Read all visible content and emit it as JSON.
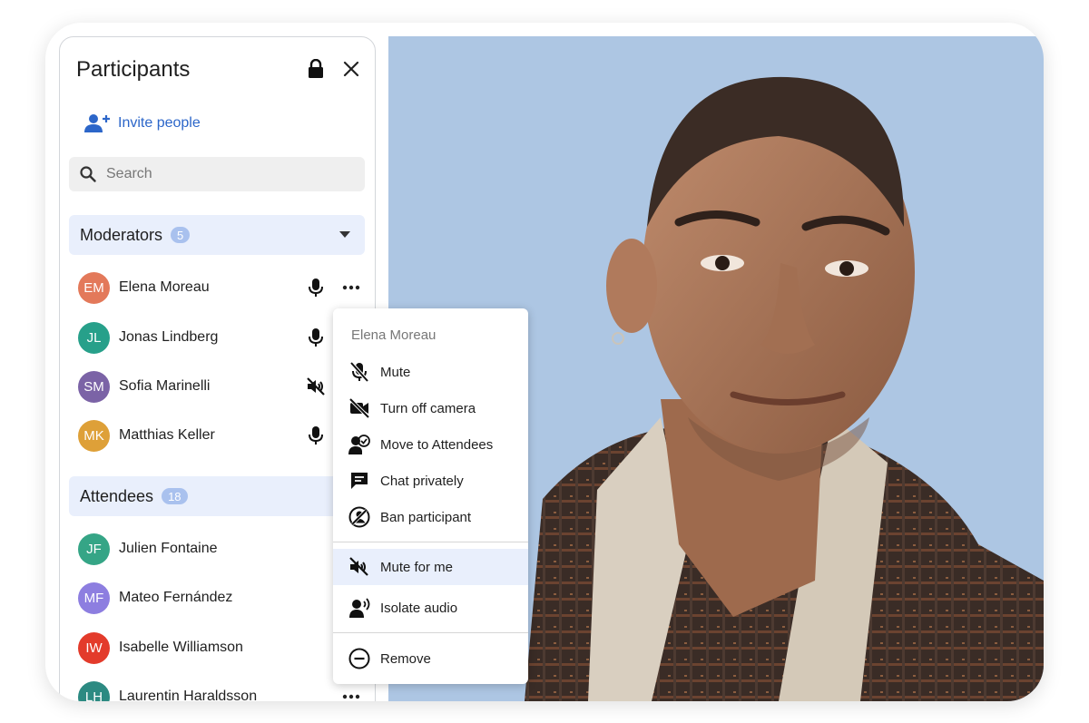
{
  "panel": {
    "title": "Participants",
    "invite_label": "Invite people",
    "search_placeholder": "Search",
    "moderators": {
      "label": "Moderators",
      "count": "5",
      "items": [
        {
          "initials": "EM",
          "name": "Elena Moreau",
          "color": "#e3795a",
          "mic": "on"
        },
        {
          "initials": "JL",
          "name": "Jonas Lindberg",
          "color": "#27a08a",
          "mic": "on"
        },
        {
          "initials": "SM",
          "name": "Sofia Marinelli",
          "color": "#7b63a6",
          "mic": "muted"
        },
        {
          "initials": "MK",
          "name": "Matthias Keller",
          "color": "#dea038",
          "mic": "on"
        }
      ]
    },
    "attendees": {
      "label": "Attendees",
      "count": "18",
      "items": [
        {
          "initials": "JF",
          "name": "Julien Fontaine",
          "color": "#35a586"
        },
        {
          "initials": "MF",
          "name": "Mateo Fernández",
          "color": "#8d7ee0"
        },
        {
          "initials": "IW",
          "name": "Isabelle Williamson",
          "color": "#e33b2b"
        },
        {
          "initials": "LH",
          "name": "Laurentin Haraldsson",
          "color": "#2c8a82"
        }
      ]
    }
  },
  "menu": {
    "title": "Elena Moreau",
    "items": [
      {
        "label": "Mute",
        "icon": "mic-off-icon"
      },
      {
        "label": "Turn off camera",
        "icon": "camera-off-icon"
      },
      {
        "label": "Move to Attendees",
        "icon": "move-user-icon"
      },
      {
        "label": "Chat privately",
        "icon": "chat-icon"
      },
      {
        "label": "Ban participant",
        "icon": "ban-icon"
      },
      {
        "label": "Mute for me",
        "icon": "speaker-off-icon"
      },
      {
        "label": "Isolate audio",
        "icon": "isolate-audio-icon"
      },
      {
        "label": "Remove",
        "icon": "remove-icon"
      }
    ]
  },
  "colors": {
    "accent": "#2c66c9",
    "section_bg": "#e9effc",
    "badge": "#a9c1ee",
    "video_bg": "#adc6e3"
  }
}
